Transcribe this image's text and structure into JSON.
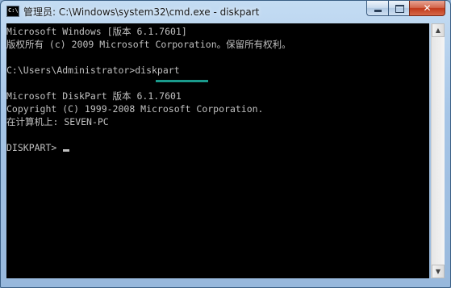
{
  "window": {
    "title": "管理员: C:\\Windows\\system32\\cmd.exe - diskpart",
    "app_icon_glyph": "C:\\"
  },
  "caption_buttons": {
    "close_symbol": "✕"
  },
  "console": {
    "lines": [
      "Microsoft Windows [版本 6.1.7601]",
      "版权所有 (c) 2009 Microsoft Corporation。保留所有权利。",
      "",
      "C:\\Users\\Administrator>diskpart",
      "",
      "Microsoft DiskPart 版本 6.1.7601",
      "Copyright (C) 1999-2008 Microsoft Corporation.",
      "在计算机上: SEVEN-PC",
      "",
      "DISKPART> "
    ],
    "text_color": "#c0c0c0",
    "background": "#000000",
    "highlight_color": "#1a9a8c"
  },
  "scrollbar": {
    "up_symbol": "▲",
    "down_symbol": "▼"
  }
}
